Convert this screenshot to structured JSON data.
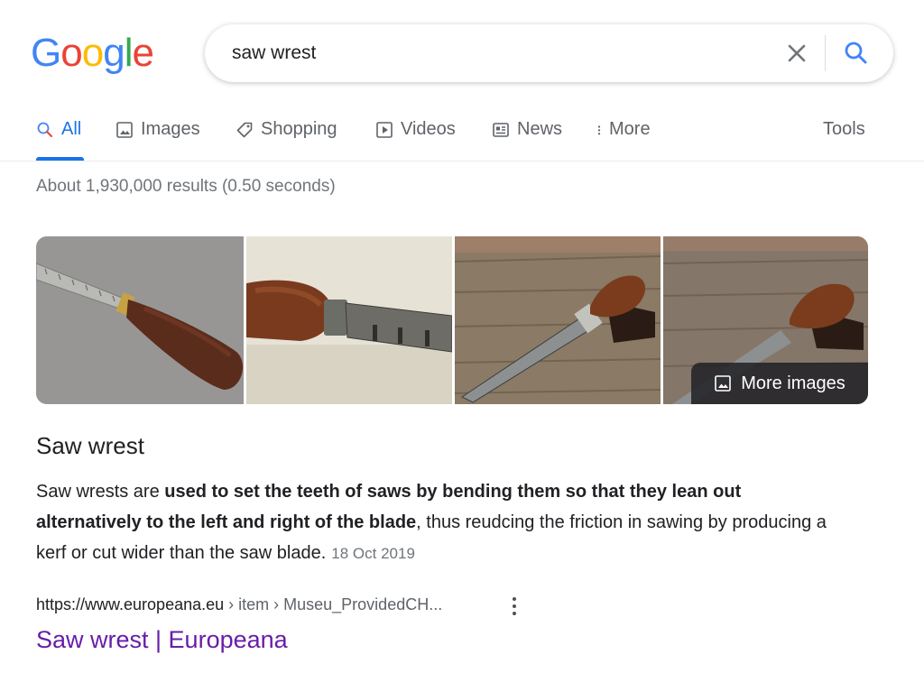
{
  "logo": {
    "letters": [
      "G",
      "o",
      "o",
      "g",
      "l",
      "e"
    ],
    "colors": [
      "#4285f4",
      "#ea4335",
      "#fbbc05",
      "#4285f4",
      "#34a853",
      "#ea4335"
    ]
  },
  "search": {
    "query": "saw wrest"
  },
  "tabs": [
    {
      "label": "All",
      "icon": "search-icon",
      "active": true
    },
    {
      "label": "Images",
      "icon": "image-icon"
    },
    {
      "label": "Shopping",
      "icon": "tag-icon"
    },
    {
      "label": "Videos",
      "icon": "play-icon"
    },
    {
      "label": "News",
      "icon": "news-icon"
    },
    {
      "label": "More",
      "icon": "more-vert-icon"
    }
  ],
  "tools_label": "Tools",
  "stats": "About 1,930,000 results (0.50 seconds)",
  "more_images_label": "More images",
  "snippet": {
    "title": "Saw wrest",
    "text_before": "Saw wrests are ",
    "text_bold": "used to set the teeth of saws by bending them so that they lean out alternatively to the left and right of the blade",
    "text_after": ", thus reudcing the friction in sawing by producing a kerf or cut wider than the saw blade.",
    "date": "18 Oct 2019"
  },
  "result": {
    "domain": "https://www.europeana.eu",
    "crumbs": " › item › Museu_ProvidedCH...",
    "title": "Saw wrest | Europeana"
  },
  "colors": {
    "accent": "#1a73e8",
    "link_visited": "#681da8"
  }
}
